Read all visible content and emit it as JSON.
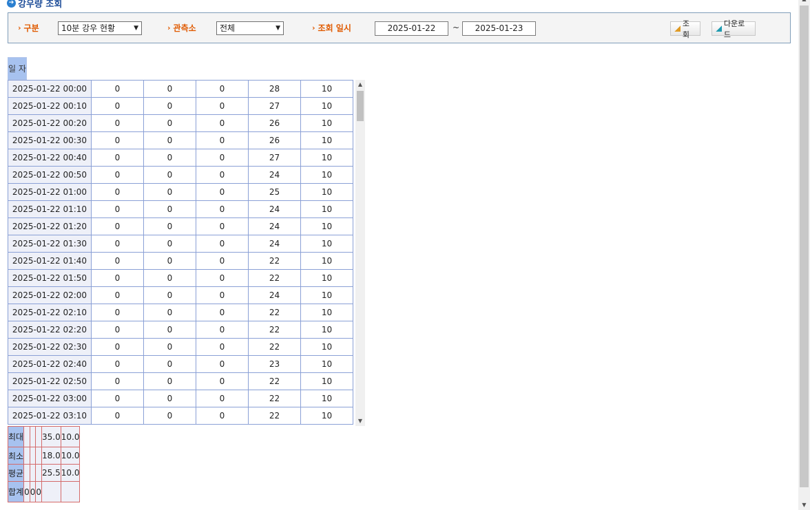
{
  "page": {
    "title": "강우량 조회"
  },
  "search": {
    "type_label": "구분",
    "type_value": "10분 강우 현황",
    "station_label": "관측소",
    "station_value": "전체",
    "date_label": "조회 일시",
    "date_from": "2025-01-22",
    "date_sep": "~",
    "date_to": "2025-01-23",
    "search_button": "조회",
    "download_button": "다운로드"
  },
  "grid": {
    "date_header": "일 자",
    "blurred_headers": [
      "",
      "",
      "",
      "",
      ""
    ],
    "rows": [
      [
        "2025-01-22 00:00",
        "0",
        "0",
        "0",
        "28",
        "10"
      ],
      [
        "2025-01-22 00:10",
        "0",
        "0",
        "0",
        "27",
        "10"
      ],
      [
        "2025-01-22 00:20",
        "0",
        "0",
        "0",
        "26",
        "10"
      ],
      [
        "2025-01-22 00:30",
        "0",
        "0",
        "0",
        "26",
        "10"
      ],
      [
        "2025-01-22 00:40",
        "0",
        "0",
        "0",
        "27",
        "10"
      ],
      [
        "2025-01-22 00:50",
        "0",
        "0",
        "0",
        "24",
        "10"
      ],
      [
        "2025-01-22 01:00",
        "0",
        "0",
        "0",
        "25",
        "10"
      ],
      [
        "2025-01-22 01:10",
        "0",
        "0",
        "0",
        "24",
        "10"
      ],
      [
        "2025-01-22 01:20",
        "0",
        "0",
        "0",
        "24",
        "10"
      ],
      [
        "2025-01-22 01:30",
        "0",
        "0",
        "0",
        "24",
        "10"
      ],
      [
        "2025-01-22 01:40",
        "0",
        "0",
        "0",
        "22",
        "10"
      ],
      [
        "2025-01-22 01:50",
        "0",
        "0",
        "0",
        "22",
        "10"
      ],
      [
        "2025-01-22 02:00",
        "0",
        "0",
        "0",
        "24",
        "10"
      ],
      [
        "2025-01-22 02:10",
        "0",
        "0",
        "0",
        "22",
        "10"
      ],
      [
        "2025-01-22 02:20",
        "0",
        "0",
        "0",
        "22",
        "10"
      ],
      [
        "2025-01-22 02:30",
        "0",
        "0",
        "0",
        "22",
        "10"
      ],
      [
        "2025-01-22 02:40",
        "0",
        "0",
        "0",
        "23",
        "10"
      ],
      [
        "2025-01-22 02:50",
        "0",
        "0",
        "0",
        "22",
        "10"
      ],
      [
        "2025-01-22 03:00",
        "0",
        "0",
        "0",
        "22",
        "10"
      ],
      [
        "2025-01-22 03:10",
        "0",
        "0",
        "0",
        "22",
        "10"
      ]
    ],
    "summary": [
      {
        "label": "최대",
        "values": [
          "",
          "",
          "",
          "35.0",
          "10.0"
        ]
      },
      {
        "label": "최소",
        "values": [
          "",
          "",
          "",
          "18.0",
          "10.0"
        ]
      },
      {
        "label": "평균",
        "values": [
          "",
          "",
          "",
          "25.5",
          "10.0"
        ]
      },
      {
        "label": "합계",
        "values": [
          "0",
          "0",
          "0",
          "",
          ""
        ]
      }
    ]
  },
  "colors": {
    "header_blue": "#a7c2ef",
    "header_red": "#e89a9a",
    "label_orange": "#e05a00",
    "title_blue": "#1f4e99"
  }
}
